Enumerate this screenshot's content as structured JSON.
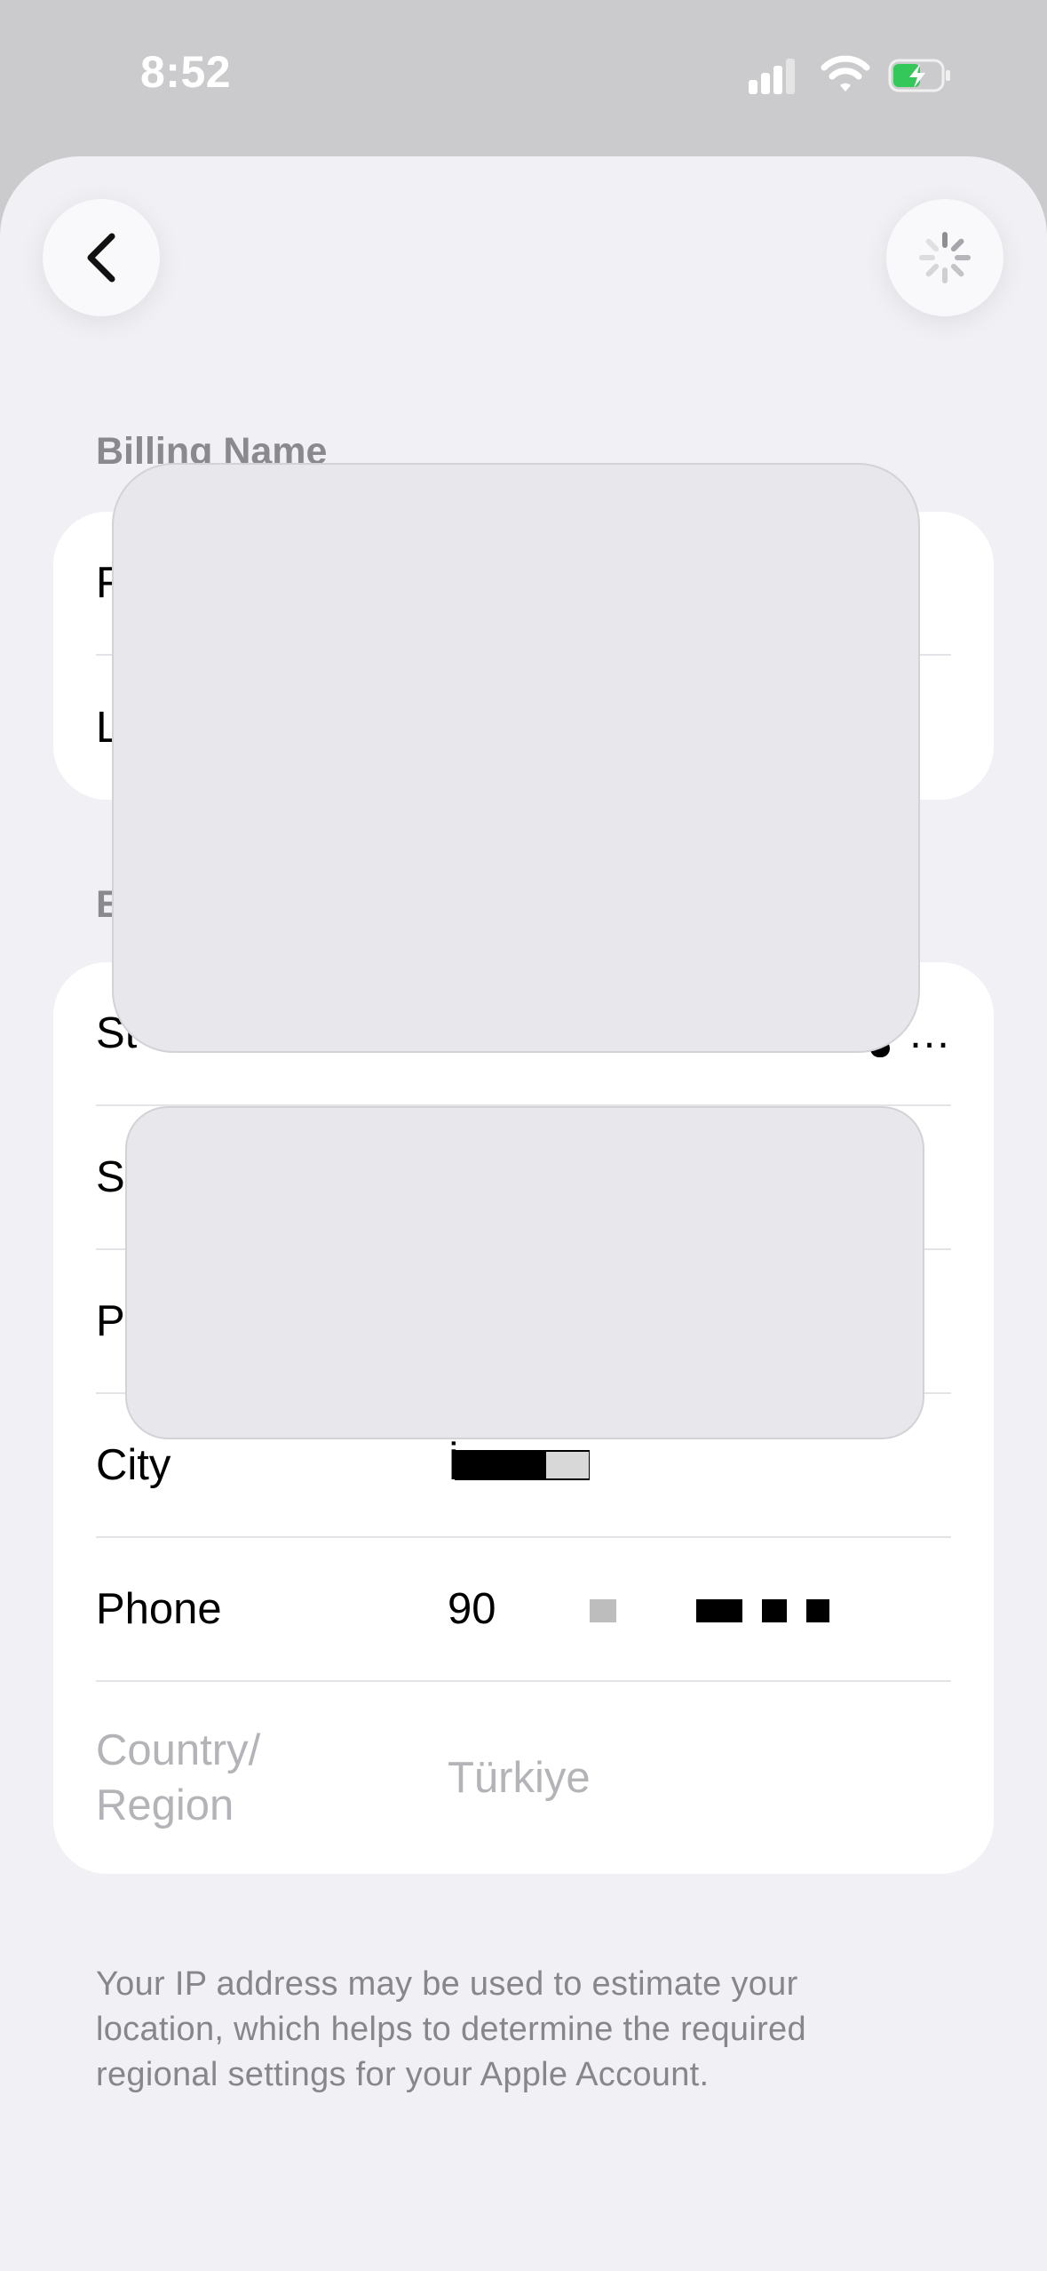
{
  "status_bar": {
    "time": "8:52"
  },
  "nav": {
    "back_icon": "chevron-left-icon",
    "spinner_icon": "loading-spinner-icon"
  },
  "billing_name": {
    "section_label": "Billing Name",
    "rows": [
      {
        "label": "F",
        "value": ""
      },
      {
        "label": "L",
        "value": ""
      }
    ]
  },
  "billing_address": {
    "section_label": "E",
    "rows": [
      {
        "label": "St",
        "value": "…"
      },
      {
        "label": "S",
        "value": ""
      },
      {
        "label": "P",
        "value": ""
      },
      {
        "label": "City",
        "value": "İ"
      },
      {
        "label": "Phone",
        "value": "90"
      },
      {
        "label": "Country/\nRegion",
        "value": "Türkiye"
      }
    ]
  },
  "footer_note": "Your IP address may be used to estimate your location, which helps to determine the required regional settings for your Apple Account."
}
